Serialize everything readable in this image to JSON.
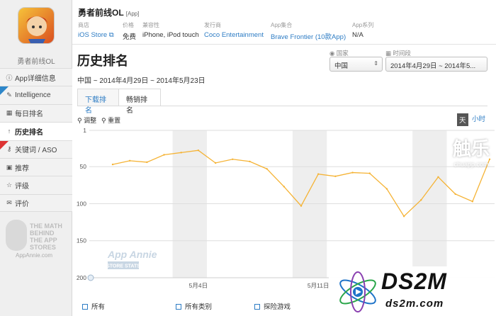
{
  "sidebar": {
    "app_name": "勇者前线OL",
    "items": [
      {
        "icon": "info-icon",
        "label": "App详细信息"
      },
      {
        "icon": "wrench-icon",
        "label": "Intelligence",
        "ribbon": "beta"
      },
      {
        "icon": "calendar-icon",
        "label": "每日排名"
      },
      {
        "icon": "arrow-up-icon",
        "label": "历史排名",
        "active": true
      },
      {
        "icon": "key-icon",
        "label": "关键词 / ASO",
        "ribbon": "new"
      },
      {
        "icon": "bookmark-icon",
        "label": "推荐"
      },
      {
        "icon": "star-icon",
        "label": "评级"
      },
      {
        "icon": "comment-icon",
        "label": "评价"
      }
    ],
    "promo": {
      "text": "THE MATH BEHIND THE APP STORES",
      "site": "AppAnnie.com"
    }
  },
  "header": {
    "title": "勇者前线OL",
    "tag": "[App]",
    "meta": [
      {
        "label": "商店",
        "value": "iOS Store ⧉",
        "link": true
      },
      {
        "label": "价格",
        "value": "免费"
      },
      {
        "label": "兼容性",
        "value": "iPhone, iPod touch"
      },
      {
        "label": "发行商",
        "value": "Coco Entertainment",
        "link": true
      },
      {
        "label": "App集合",
        "value": "Brave Frontier (10款App)",
        "link": true
      },
      {
        "label": "App系列",
        "value": "N/A"
      }
    ]
  },
  "page_title": "历史排名",
  "date_range": "中国 ~ 2014年4月29日 ~ 2014年5月23日",
  "filters": {
    "country_label": "国家",
    "country_value": "中国",
    "period_label": "时间段",
    "period_value": "2014年4月29日 ~ 2014年5..."
  },
  "tabs": [
    "下载排名",
    "畅销排名"
  ],
  "toolbar": {
    "zoom": "调整",
    "reset": "重置",
    "day": "天",
    "hour": "小时"
  },
  "chart_data": {
    "type": "line",
    "title": "",
    "xlabel": "",
    "ylabel": "",
    "x": [
      "2014-04-29",
      "2014-04-30",
      "2014-05-01",
      "2014-05-02",
      "2014-05-03",
      "2014-05-04",
      "2014-05-05",
      "2014-05-06",
      "2014-05-07",
      "2014-05-08",
      "2014-05-09",
      "2014-05-10",
      "2014-05-11",
      "2014-05-12",
      "2014-05-13",
      "2014-05-14",
      "2014-05-15",
      "2014-05-16",
      "2014-05-17",
      "2014-05-18",
      "2014-05-19",
      "2014-05-20",
      "2014-05-21"
    ],
    "series": [
      {
        "values": [
          47,
          42,
          44,
          34,
          31,
          28,
          45,
          40,
          43,
          53,
          77,
          103,
          60,
          63,
          58,
          59,
          80,
          117,
          95,
          64,
          87,
          97,
          40
        ]
      }
    ],
    "y_ticks": [
      "1",
      "50",
      "100",
      "150",
      "200"
    ],
    "ylim": [
      1,
      200
    ],
    "y_inverted": true,
    "x_tick_labels": [
      "5月4日",
      "5月11日"
    ],
    "line_color": "#f5b335",
    "grid": true
  },
  "chart_watermark": {
    "line1": "App Annie",
    "line2": "STORE STATS"
  },
  "checkboxes": [
    "所有",
    "所有类别",
    "探险游戏"
  ],
  "watermarks": {
    "chuapp_big": "触乐",
    "chuapp_small": "chuapp.com",
    "ds2m_logo": "DS2M",
    "ds2m_url": "ds2m.com"
  },
  "colors": {
    "accent": "#2d7cc4",
    "line": "#f5b335"
  }
}
